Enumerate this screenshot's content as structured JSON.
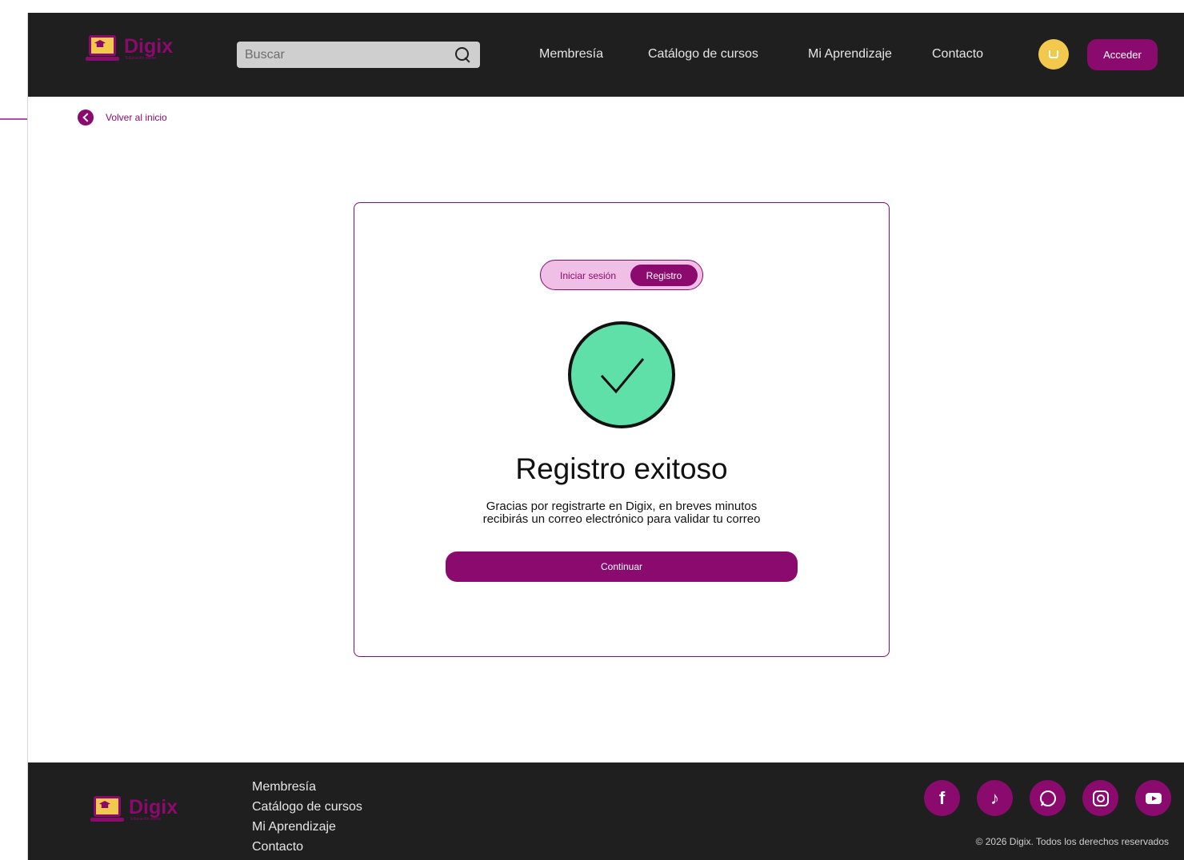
{
  "brand": {
    "name": "Digix",
    "tagline": "Educación online"
  },
  "header": {
    "search_placeholder": "Buscar",
    "nav": [
      "Membresía",
      "Catálogo de cursos",
      "Mi Aprendizaje",
      "Contacto"
    ],
    "login_label": "Acceder"
  },
  "back_link": "Volver al inicio",
  "card": {
    "tabs": {
      "login": "Iniciar sesión",
      "register": "Registro",
      "active": "register"
    },
    "title": "Registro exitoso",
    "message_line1": "Gracias por registrarte en Digix, en breves minutos",
    "message_line2": "recibirás un correo electrónico para validar tu correo",
    "continue_label": "Continuar"
  },
  "footer": {
    "links": [
      "Membresía",
      "Catálogo de cursos",
      "Mi Aprendizaje",
      "Contacto"
    ],
    "social": [
      "facebook-icon",
      "tiktok-icon",
      "whatsapp-icon",
      "instagram-icon",
      "youtube-icon"
    ],
    "copyright": "© 2026 Digix. Todos los derechos reservados"
  },
  "colors": {
    "primary": "#8b0a6e",
    "accent": "#f2c94c",
    "success": "#5ee0a8",
    "dark": "#1f1f1f"
  }
}
